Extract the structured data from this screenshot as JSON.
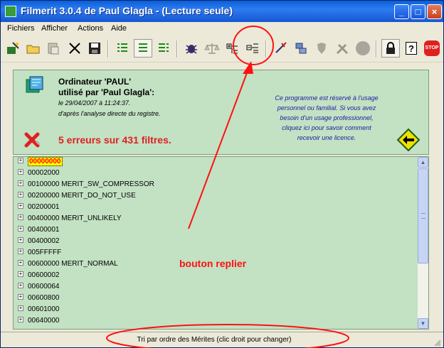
{
  "window": {
    "title": "Filmerit 3.0.4 de Paul Glagla - (Lecture seule)"
  },
  "title_buttons": {
    "minimize": "_",
    "maximize": "□",
    "close": "×"
  },
  "menu": [
    "Fichiers",
    "Afficher",
    "Actions",
    "Aide"
  ],
  "toolbar_icons": [
    "wizard-icon",
    "open-folder-icon",
    "paste-icon",
    "cut-icon",
    "save-icon",
    "list-view-icon",
    "list-view-pressed-icon",
    "list-view-alt-icon",
    "bug-icon",
    "balance-icon",
    "expand-tree-icon",
    "collapse-tree-icon",
    "dart-icon",
    "network-icon",
    "shield-icon",
    "tools-icon",
    "disc-icon",
    "lock-icon",
    "help-icon",
    "stop-icon"
  ],
  "stop_label": "STOP",
  "help_label": "?",
  "info": {
    "computer_line": "Ordinateur 'PAUL'",
    "user_line": "utilisé par 'Paul Glagla':",
    "date_line": "le 29/04/2007 à 11:24:37.",
    "analysis_line": "d'après l'analyse directe du registre.",
    "errors": "5 erreurs sur 431 filtres.",
    "license_lines": [
      "Ce programme est réservé à l'usage",
      "personnel ou familial.  Si vous avez",
      "besoin d'un usage professionnel,",
      "cliquez ici pour savoir comment",
      "recevoir une licence."
    ]
  },
  "tree": {
    "rows": [
      {
        "code": "00000000",
        "name": "",
        "selected": true
      },
      {
        "code": "00002000",
        "name": ""
      },
      {
        "code": "00100000",
        "name": "MERIT_SW_COMPRESSOR"
      },
      {
        "code": "00200000",
        "name": "MERIT_DO_NOT_USE"
      },
      {
        "code": "00200001",
        "name": ""
      },
      {
        "code": "00400000",
        "name": "MERIT_UNLIKELY"
      },
      {
        "code": "00400001",
        "name": ""
      },
      {
        "code": "00400002",
        "name": ""
      },
      {
        "code": "005FFFFF",
        "name": ""
      },
      {
        "code": "00600000",
        "name": "MERIT_NORMAL"
      },
      {
        "code": "00600002",
        "name": ""
      },
      {
        "code": "00600064",
        "name": ""
      },
      {
        "code": "00600800",
        "name": ""
      },
      {
        "code": "00601000",
        "name": ""
      },
      {
        "code": "00640000",
        "name": ""
      }
    ]
  },
  "status": {
    "text": "Tri par ordre des Mérites (clic droit pour changer)"
  },
  "annotation": {
    "label": "bouton replier",
    "color": "#ff1010"
  }
}
